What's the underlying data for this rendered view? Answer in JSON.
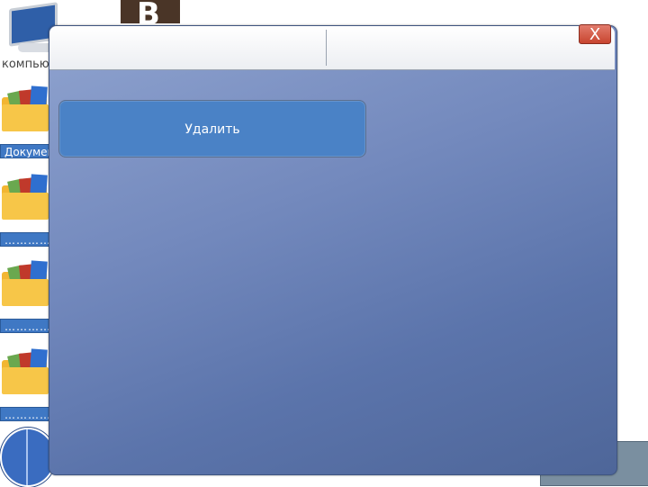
{
  "desktop": {
    "computer_label": "компьютер",
    "documents_label": "Документы",
    "folder_labels": [
      "…………",
      "…………",
      "…………"
    ],
    "b_tile": "B"
  },
  "dialog": {
    "close_label": "X",
    "delete_label": "Удалить"
  },
  "colors": {
    "dialog_top": "#8fa3cf",
    "dialog_bottom": "#4e6699",
    "button_blue": "#4a82c6",
    "close_red": "#c8452f"
  }
}
